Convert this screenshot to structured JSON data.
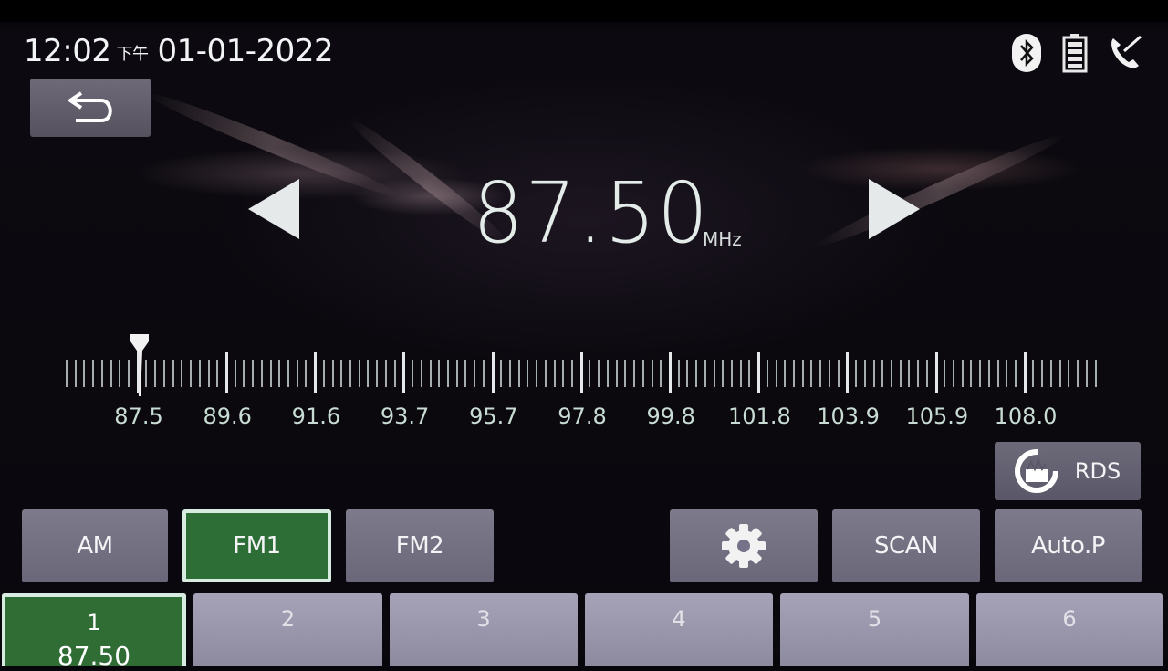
{
  "status": {
    "time": "12:02",
    "ampm": "下午",
    "date": "01-01-2022"
  },
  "system_icons": [
    "bluetooth-icon",
    "battery-icon",
    "phone-off-icon"
  ],
  "tuner": {
    "frequency": "87.50",
    "unit": "MHz"
  },
  "dial": {
    "labels": [
      "87.5",
      "89.6",
      "91.6",
      "93.7",
      "95.7",
      "97.8",
      "99.8",
      "101.8",
      "103.9",
      "105.9",
      "108.0"
    ]
  },
  "buttons": {
    "rds": "RDS",
    "am": "AM",
    "fm1": "FM1",
    "fm2": "FM2",
    "scan": "SCAN",
    "autop": "Auto.P"
  },
  "presets": [
    {
      "num": "1",
      "freq": "87.50"
    },
    {
      "num": "2",
      "freq": ""
    },
    {
      "num": "3",
      "freq": ""
    },
    {
      "num": "4",
      "freq": ""
    },
    {
      "num": "5",
      "freq": ""
    },
    {
      "num": "6",
      "freq": ""
    }
  ],
  "colors": {
    "active": "#2d6e36",
    "button": "#7d7a8b",
    "accent_text": "#c8dcd4"
  }
}
